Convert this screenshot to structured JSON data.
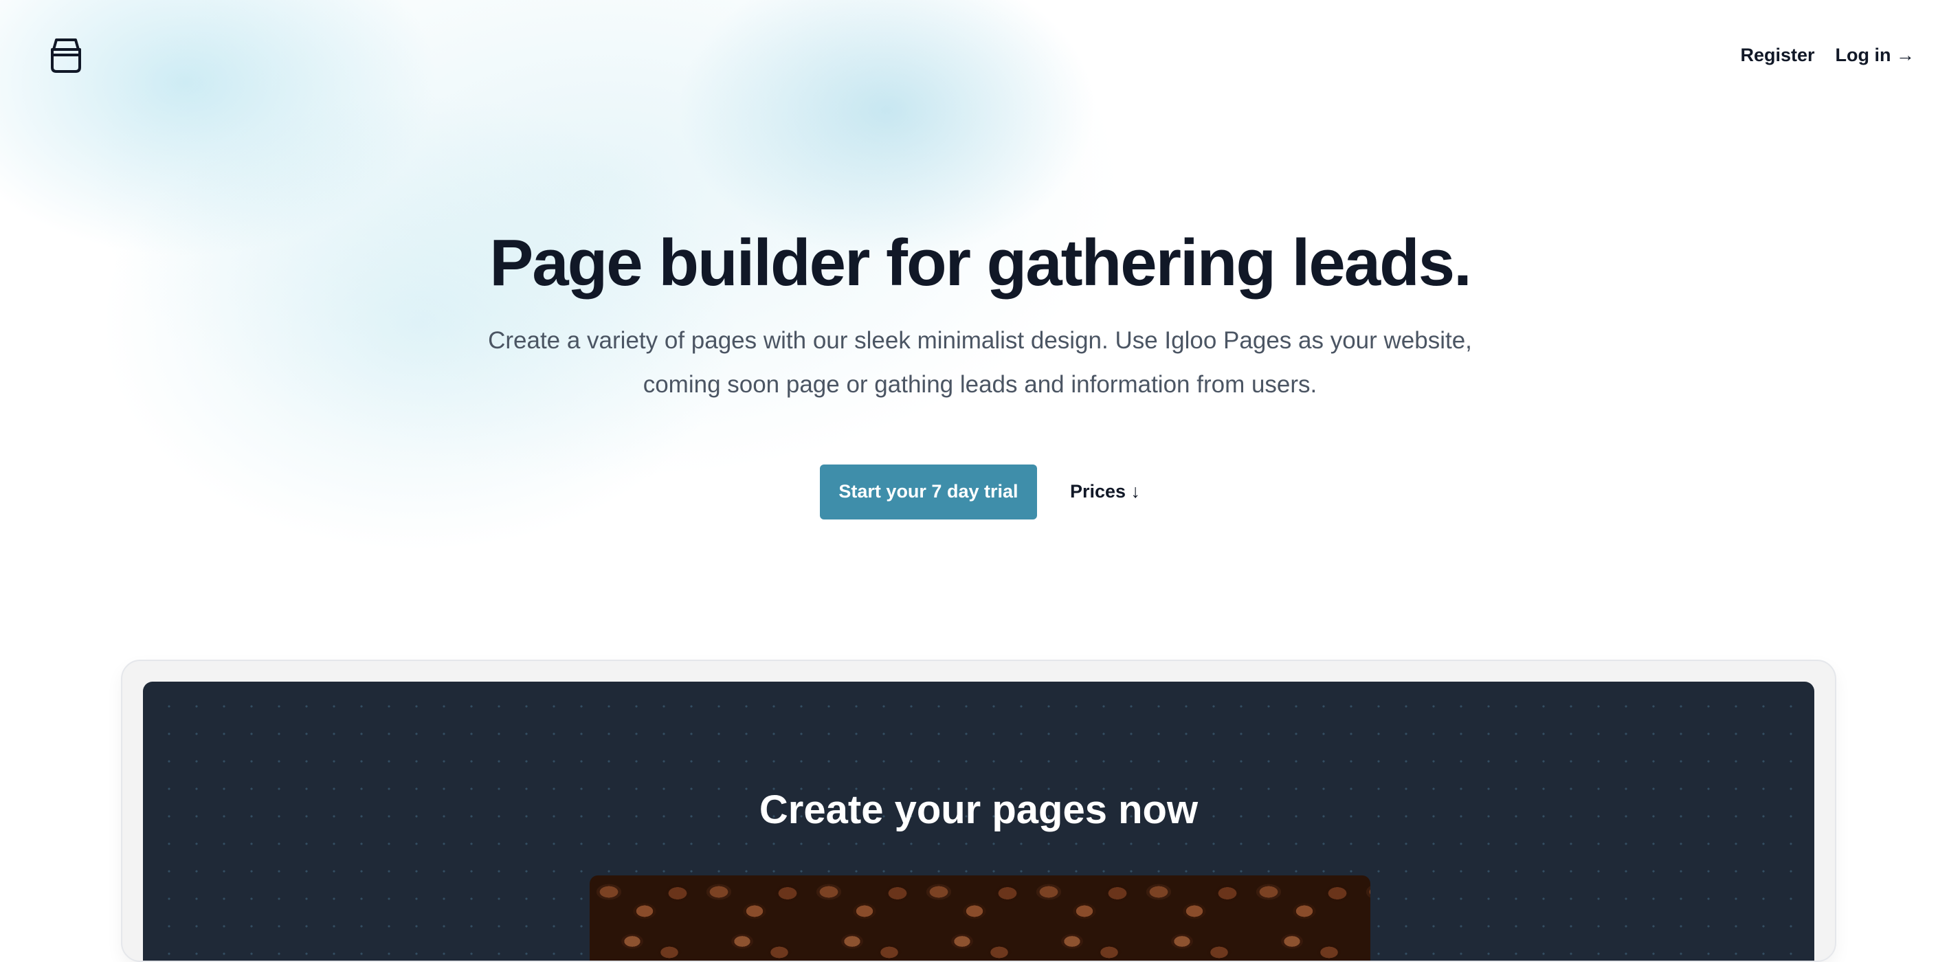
{
  "header": {
    "logo_icon": "stacked-box-icon",
    "nav": {
      "register": "Register",
      "login": "Log in →"
    }
  },
  "hero": {
    "title": "Page builder for gathering leads.",
    "subtitle": "Create a variety of pages with our sleek minimalist design. Use Igloo Pages as your website, coming soon page or gathing leads and information from users.",
    "primary_cta": "Start your 7 day trial",
    "secondary_cta": "Prices ↓"
  },
  "preview": {
    "title": "Create your pages now",
    "image_alt": "coffee-beans-image"
  },
  "colors": {
    "accent": "#3f8eaa",
    "dark_panel": "#1f2937",
    "text_primary": "#111827",
    "text_secondary": "#4b5563"
  }
}
